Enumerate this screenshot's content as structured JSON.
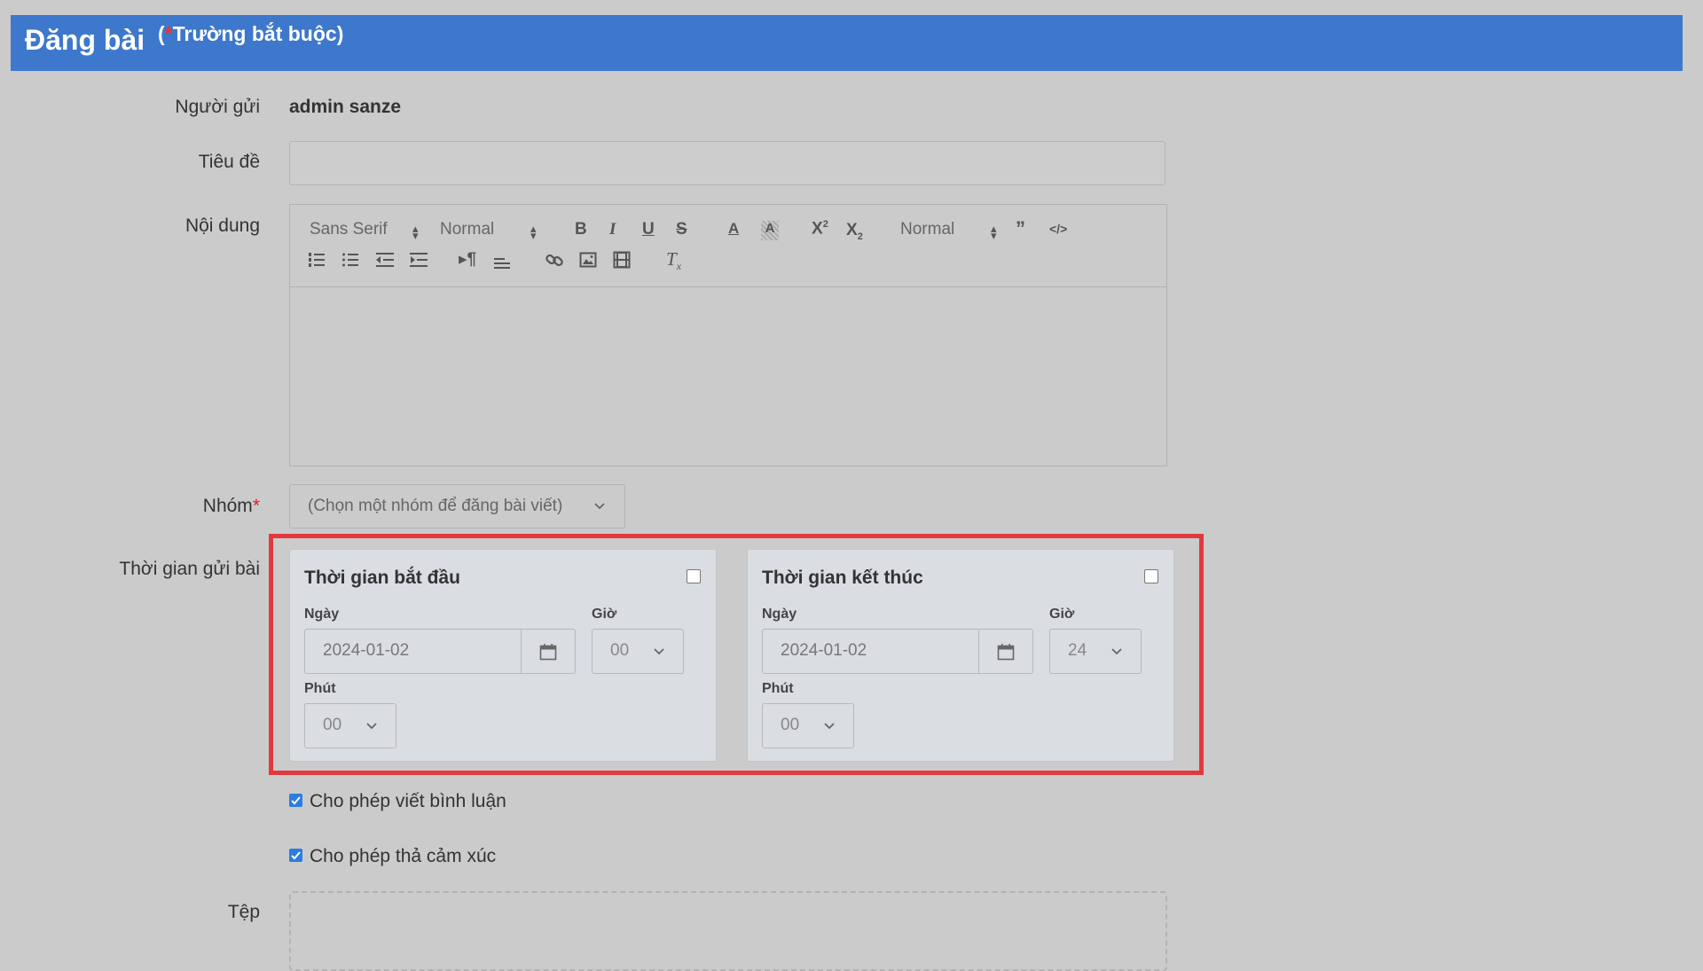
{
  "header": {
    "title": "Đăng bài",
    "required_star": "*",
    "required_note": "Trường bắt buộc"
  },
  "form": {
    "sender": {
      "label": "Người gửi",
      "value": "admin sanze"
    },
    "title": {
      "label": "Tiêu đề",
      "value": ""
    },
    "content": {
      "label": "Nội dung",
      "toolbar": {
        "font_family": "Sans Serif",
        "font_size": "Normal",
        "header_select": "Normal",
        "buttons": [
          "bold",
          "italic",
          "underline",
          "strike",
          "color",
          "background",
          "superscript",
          "subscript",
          "blockquote",
          "code-block",
          "ordered-list",
          "bullet-list",
          "outdent",
          "indent",
          "direction",
          "align",
          "link",
          "image",
          "video",
          "clean"
        ]
      },
      "body": ""
    },
    "group": {
      "label": "Nhóm",
      "star": "*",
      "placeholder": "(Chọn một nhóm để đăng bài viết)"
    },
    "post_time": {
      "label": "Thời gian gửi bài",
      "start": {
        "title": "Thời gian bắt đầu",
        "enabled": false,
        "date_label": "Ngày",
        "date": "2024-01-02",
        "hour_label": "Giờ",
        "hour": "00",
        "minute_label": "Phút",
        "minute": "00"
      },
      "end": {
        "title": "Thời gian kết thúc",
        "enabled": false,
        "date_label": "Ngày",
        "date": "2024-01-02",
        "hour_label": "Giờ",
        "hour": "24",
        "minute_label": "Phút",
        "minute": "00"
      }
    },
    "allow_comments": {
      "label": "Cho phép viết bình luận",
      "checked": true
    },
    "allow_reactions": {
      "label": "Cho phép thả cảm xúc",
      "checked": true
    },
    "file": {
      "label": "Tệp"
    }
  },
  "colors": {
    "header": "#3d78cc",
    "highlight": "#e03a3e",
    "checkbox": "#2a7de1",
    "background": "#cbcbcb"
  }
}
